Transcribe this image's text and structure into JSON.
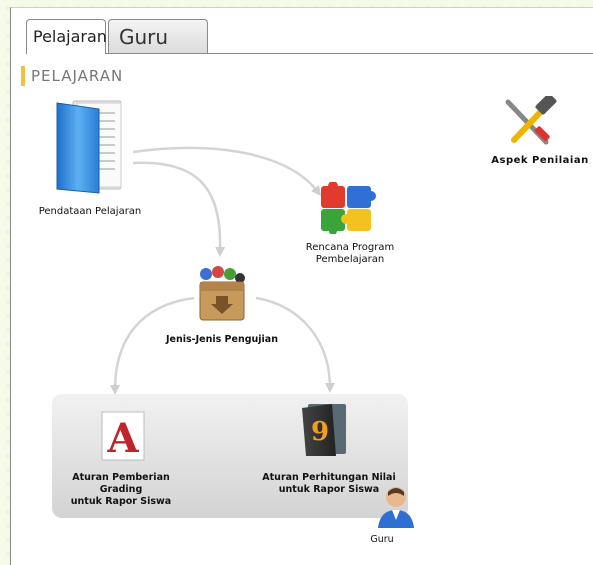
{
  "tabs": [
    {
      "label": "Pelajaran",
      "active": true
    },
    {
      "label": "Guru",
      "active": false
    }
  ],
  "section": {
    "title": "PELAJARAN",
    "accent": "#f0c040"
  },
  "nodes": {
    "pendataan": {
      "label": "Pendataan Pelajaran",
      "icon": "blue-folder-icon"
    },
    "rencana": {
      "line1": "Rencana Program",
      "line2": "Pembelajaran",
      "icon": "puzzle-icon"
    },
    "aspek": {
      "label": "Aspek Penilaian",
      "icon": "tools-icon"
    },
    "jenis": {
      "label": "Jenis-Jenis Pengujian",
      "icon": "package-icon"
    },
    "grading": {
      "line1": "Aturan Pemberian Grading",
      "line2": "untuk Rapor Siswa",
      "icon": "letter-a-icon"
    },
    "perhitungan": {
      "line1": "Aturan Perhitungan Nilai",
      "line2": "untuk Rapor Siswa",
      "icon": "number-nine-book-icon"
    },
    "guru": {
      "label": "Guru",
      "icon": "user-icon"
    }
  }
}
